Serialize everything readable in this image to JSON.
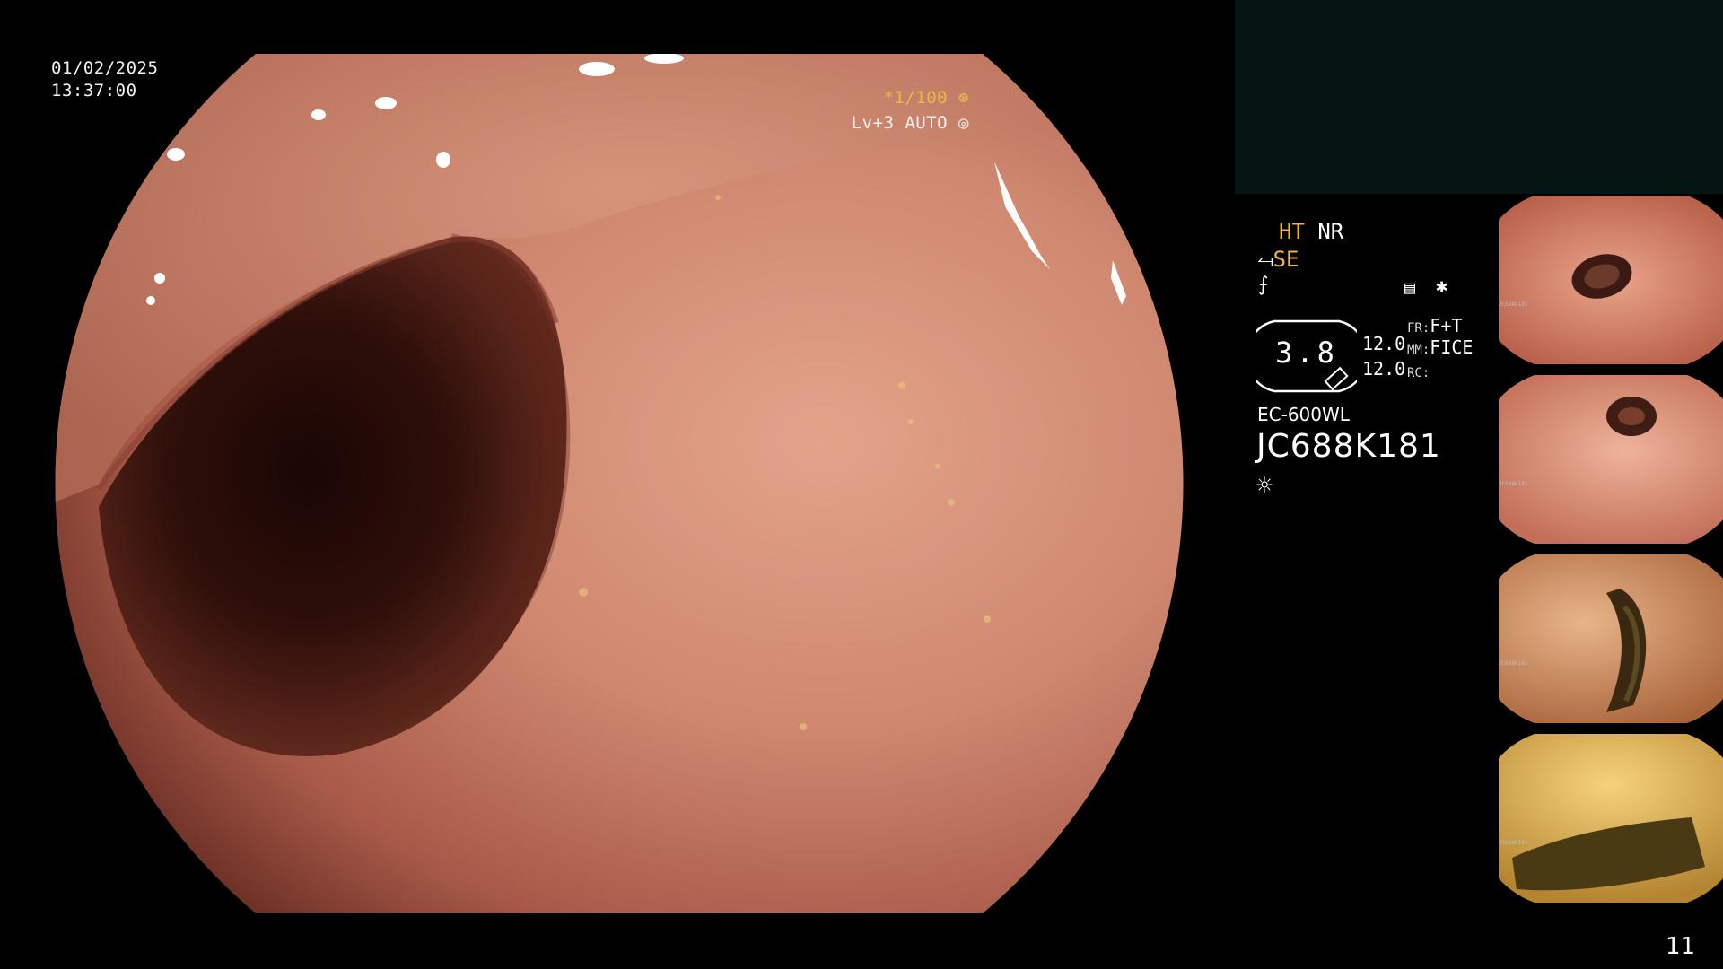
{
  "osd": {
    "date": "01/02/2025",
    "time": "13:37:00",
    "shutter": "*1/100",
    "level": "Lv+3 AUTO"
  },
  "panel": {
    "ht": "HT",
    "nr": "NR",
    "se": "SE",
    "gauge_value": "3.8",
    "val1": "12.0",
    "val2": "12.0",
    "fr_label": "FR:",
    "fr_value": "F+T",
    "mm_label": "MM:",
    "mm_value": "FICE",
    "rc_label": "RC:",
    "model": "EC-600WL",
    "serial": "JC688K181"
  },
  "thumbnails": [
    {
      "caption": "JC688K181"
    },
    {
      "caption": "JC688K181"
    },
    {
      "caption": "JC688K181"
    },
    {
      "caption": "JC688K181"
    }
  ],
  "page_number": "11",
  "colors": {
    "mucosa": "#c9826a",
    "lumen": "#2a0d08",
    "accent_yellow": "#f0b53a",
    "side_block": "#041513"
  }
}
